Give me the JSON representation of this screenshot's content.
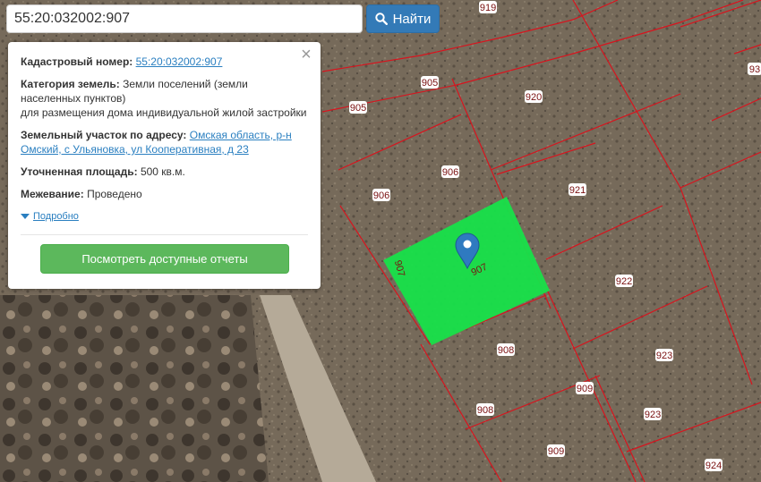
{
  "search": {
    "value": "55:20:032002:907",
    "button_label": "Найти"
  },
  "info": {
    "cadastral_label": "Кадастровый номер:",
    "cadastral_value": "55:20:032002:907",
    "category_label": "Категория земель:",
    "category_value": "Земли поселений (земли населенных пунктов)",
    "category_usage": "для размещения дома индивидуальной жилой застройки",
    "address_label": "Земельный участок по адресу:",
    "address_value": "Омская область, р-н Омский, с Ульяновка, ул Кооперативная, д 23",
    "area_label": "Уточненная площадь:",
    "area_value": "500 кв.м.",
    "survey_label": "Межевание:",
    "survey_value": "Проведено",
    "details_link": "Подробно",
    "reports_button": "Посмотреть доступные отчеты",
    "close_icon": "close-icon"
  },
  "map": {
    "plot_labels": [
      "919",
      "905",
      "920",
      "905",
      "906",
      "921",
      "906",
      "907",
      "922",
      "908",
      "923",
      "909",
      "908",
      "923",
      "909",
      "924",
      "93",
      "907"
    ],
    "highlight_color": "#17e24a",
    "boundary_color": "#d8141e",
    "marker_color": "#2f7ac0"
  }
}
